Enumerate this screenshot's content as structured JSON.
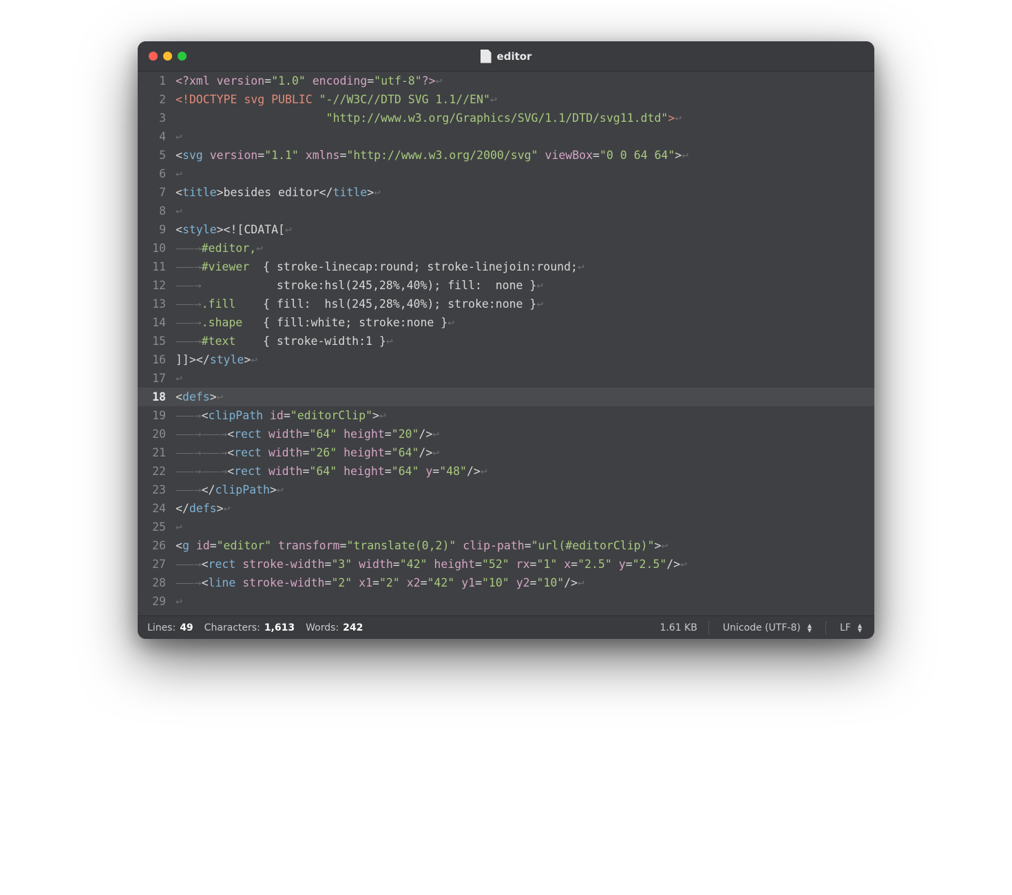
{
  "window": {
    "title": "editor"
  },
  "highlighted_line": 18,
  "invisibles": {
    "newline": "↩",
    "tab": "⸺→"
  },
  "lines": [
    {
      "n": 1,
      "tokens": [
        [
          "<?",
          "pi"
        ],
        [
          "xml ",
          "pi"
        ],
        [
          "version",
          "attr"
        ],
        [
          "=",
          ""
        ],
        [
          "\"1.0\"",
          "str"
        ],
        [
          " ",
          ""
        ],
        [
          "encoding",
          "attr"
        ],
        [
          "=",
          ""
        ],
        [
          "\"utf-8\"",
          "str"
        ],
        [
          "?>",
          "pi"
        ]
      ]
    },
    {
      "n": 2,
      "tokens": [
        [
          "<!DOCTYPE svg PUBLIC ",
          "doctype"
        ],
        [
          "\"-//W3C//DTD SVG 1.1//EN\"",
          "str"
        ]
      ]
    },
    {
      "n": 3,
      "indent": 0,
      "tokens": [
        [
          "                      ",
          ""
        ],
        [
          "\"http://www.w3.org/Graphics/SVG/1.1/DTD/svg11.dtd\"",
          "str"
        ],
        [
          ">",
          "doctype"
        ]
      ]
    },
    {
      "n": 4,
      "tokens": []
    },
    {
      "n": 5,
      "tokens": [
        [
          "<",
          ""
        ],
        [
          "svg",
          "tag"
        ],
        [
          " ",
          ""
        ],
        [
          "version",
          "attr"
        ],
        [
          "=",
          ""
        ],
        [
          "\"1.1\"",
          "str"
        ],
        [
          " ",
          ""
        ],
        [
          "xmlns",
          "attr"
        ],
        [
          "=",
          ""
        ],
        [
          "\"http://www.w3.org/2000/svg\"",
          "str"
        ],
        [
          " ",
          ""
        ],
        [
          "viewBox",
          "attr"
        ],
        [
          "=",
          ""
        ],
        [
          "\"0 0 64 64\"",
          "str"
        ],
        [
          ">",
          ""
        ]
      ]
    },
    {
      "n": 6,
      "tokens": []
    },
    {
      "n": 7,
      "tokens": [
        [
          "<",
          ""
        ],
        [
          "title",
          "tag"
        ],
        [
          ">",
          ""
        ],
        [
          "besides editor",
          ""
        ],
        [
          "</",
          ""
        ],
        [
          "title",
          "tag"
        ],
        [
          ">",
          ""
        ]
      ]
    },
    {
      "n": 8,
      "tokens": []
    },
    {
      "n": 9,
      "tokens": [
        [
          "<",
          ""
        ],
        [
          "style",
          "tag"
        ],
        [
          ">",
          ""
        ],
        [
          "<![CDATA[",
          "cdata"
        ]
      ]
    },
    {
      "n": 10,
      "indent": 1,
      "tokens": [
        [
          "#editor,",
          "css-sel"
        ]
      ]
    },
    {
      "n": 11,
      "indent": 1,
      "tokens": [
        [
          "#viewer  ",
          "css-sel"
        ],
        [
          "{ ",
          ""
        ],
        [
          "stroke-linecap:round; stroke-linejoin:round;",
          "css-prop"
        ]
      ]
    },
    {
      "n": 12,
      "indent": 1,
      "tokens": [
        [
          "           stroke:hsl(245,28%,40%); fill:  none }",
          "css-prop"
        ]
      ]
    },
    {
      "n": 13,
      "indent": 1,
      "tokens": [
        [
          ".fill    ",
          "css-sel"
        ],
        [
          "{ ",
          ""
        ],
        [
          "fill:  hsl(245,28%,40%); stroke:none }",
          "css-prop"
        ]
      ]
    },
    {
      "n": 14,
      "indent": 1,
      "tokens": [
        [
          ".shape   ",
          "css-sel"
        ],
        [
          "{ ",
          ""
        ],
        [
          "fill:white; stroke:none }",
          "css-prop"
        ]
      ]
    },
    {
      "n": 15,
      "indent": 1,
      "tokens": [
        [
          "#text    ",
          "css-sel"
        ],
        [
          "{ ",
          ""
        ],
        [
          "stroke-width:1 }",
          "css-prop"
        ]
      ]
    },
    {
      "n": 16,
      "tokens": [
        [
          "]]>",
          "cdata"
        ],
        [
          "</",
          ""
        ],
        [
          "style",
          "tag"
        ],
        [
          ">",
          ""
        ]
      ]
    },
    {
      "n": 17,
      "tokens": []
    },
    {
      "n": 18,
      "tokens": [
        [
          "<",
          ""
        ],
        [
          "defs",
          "tag"
        ],
        [
          ">",
          ""
        ]
      ]
    },
    {
      "n": 19,
      "indent": 1,
      "tokens": [
        [
          "<",
          ""
        ],
        [
          "clipPath",
          "tag"
        ],
        [
          " ",
          ""
        ],
        [
          "id",
          "attr"
        ],
        [
          "=",
          ""
        ],
        [
          "\"editorClip\"",
          "str"
        ],
        [
          ">",
          ""
        ]
      ]
    },
    {
      "n": 20,
      "indent": 2,
      "tokens": [
        [
          "<",
          ""
        ],
        [
          "rect",
          "tag"
        ],
        [
          " ",
          ""
        ],
        [
          "width",
          "attr"
        ],
        [
          "=",
          ""
        ],
        [
          "\"64\"",
          "str"
        ],
        [
          " ",
          ""
        ],
        [
          "height",
          "attr"
        ],
        [
          "=",
          ""
        ],
        [
          "\"20\"",
          "str"
        ],
        [
          "/>",
          ""
        ]
      ]
    },
    {
      "n": 21,
      "indent": 2,
      "tokens": [
        [
          "<",
          ""
        ],
        [
          "rect",
          "tag"
        ],
        [
          " ",
          ""
        ],
        [
          "width",
          "attr"
        ],
        [
          "=",
          ""
        ],
        [
          "\"26\"",
          "str"
        ],
        [
          " ",
          ""
        ],
        [
          "height",
          "attr"
        ],
        [
          "=",
          ""
        ],
        [
          "\"64\"",
          "str"
        ],
        [
          "/>",
          ""
        ]
      ]
    },
    {
      "n": 22,
      "indent": 2,
      "tokens": [
        [
          "<",
          ""
        ],
        [
          "rect",
          "tag"
        ],
        [
          " ",
          ""
        ],
        [
          "width",
          "attr"
        ],
        [
          "=",
          ""
        ],
        [
          "\"64\"",
          "str"
        ],
        [
          " ",
          ""
        ],
        [
          "height",
          "attr"
        ],
        [
          "=",
          ""
        ],
        [
          "\"64\"",
          "str"
        ],
        [
          " ",
          ""
        ],
        [
          "y",
          "attr"
        ],
        [
          "=",
          ""
        ],
        [
          "\"48\"",
          "str"
        ],
        [
          "/>",
          ""
        ]
      ]
    },
    {
      "n": 23,
      "indent": 1,
      "tokens": [
        [
          "</",
          ""
        ],
        [
          "clipPath",
          "tag"
        ],
        [
          ">",
          ""
        ]
      ]
    },
    {
      "n": 24,
      "tokens": [
        [
          "</",
          ""
        ],
        [
          "defs",
          "tag"
        ],
        [
          ">",
          ""
        ]
      ]
    },
    {
      "n": 25,
      "tokens": []
    },
    {
      "n": 26,
      "tokens": [
        [
          "<",
          ""
        ],
        [
          "g",
          "tag"
        ],
        [
          " ",
          ""
        ],
        [
          "id",
          "attr"
        ],
        [
          "=",
          ""
        ],
        [
          "\"editor\"",
          "str"
        ],
        [
          " ",
          ""
        ],
        [
          "transform",
          "attr"
        ],
        [
          "=",
          ""
        ],
        [
          "\"translate(0,2)\"",
          "str"
        ],
        [
          " ",
          ""
        ],
        [
          "clip-path",
          "attr"
        ],
        [
          "=",
          ""
        ],
        [
          "\"url(#editorClip)\"",
          "str"
        ],
        [
          ">",
          ""
        ]
      ]
    },
    {
      "n": 27,
      "indent": 1,
      "tokens": [
        [
          "<",
          ""
        ],
        [
          "rect",
          "tag"
        ],
        [
          " ",
          ""
        ],
        [
          "stroke-width",
          "attr"
        ],
        [
          "=",
          ""
        ],
        [
          "\"3\"",
          "str"
        ],
        [
          " ",
          ""
        ],
        [
          "width",
          "attr"
        ],
        [
          "=",
          ""
        ],
        [
          "\"42\"",
          "str"
        ],
        [
          " ",
          ""
        ],
        [
          "height",
          "attr"
        ],
        [
          "=",
          ""
        ],
        [
          "\"52\"",
          "str"
        ],
        [
          " ",
          ""
        ],
        [
          "rx",
          "attr"
        ],
        [
          "=",
          ""
        ],
        [
          "\"1\"",
          "str"
        ],
        [
          " ",
          ""
        ],
        [
          "x",
          "attr"
        ],
        [
          "=",
          ""
        ],
        [
          "\"2.5\"",
          "str"
        ],
        [
          " ",
          ""
        ],
        [
          "y",
          "attr"
        ],
        [
          "=",
          ""
        ],
        [
          "\"2.5\"",
          "str"
        ],
        [
          "/>",
          ""
        ]
      ]
    },
    {
      "n": 28,
      "indent": 1,
      "tokens": [
        [
          "<",
          ""
        ],
        [
          "line",
          "tag"
        ],
        [
          " ",
          ""
        ],
        [
          "stroke-width",
          "attr"
        ],
        [
          "=",
          ""
        ],
        [
          "\"2\"",
          "str"
        ],
        [
          " ",
          ""
        ],
        [
          "x1",
          "attr"
        ],
        [
          "=",
          ""
        ],
        [
          "\"2\"",
          "str"
        ],
        [
          " ",
          ""
        ],
        [
          "x2",
          "attr"
        ],
        [
          "=",
          ""
        ],
        [
          "\"42\"",
          "str"
        ],
        [
          " ",
          ""
        ],
        [
          "y1",
          "attr"
        ],
        [
          "=",
          ""
        ],
        [
          "\"10\"",
          "str"
        ],
        [
          " ",
          ""
        ],
        [
          "y2",
          "attr"
        ],
        [
          "=",
          ""
        ],
        [
          "\"10\"",
          "str"
        ],
        [
          "/>",
          ""
        ]
      ]
    },
    {
      "n": 29,
      "tokens": []
    }
  ],
  "status": {
    "lines_label": "Lines:",
    "lines_value": "49",
    "chars_label": "Characters:",
    "chars_value": "1,613",
    "words_label": "Words:",
    "words_value": "242",
    "filesize": "1.61 KB",
    "encoding": "Unicode (UTF-8)",
    "line_ending": "LF"
  }
}
